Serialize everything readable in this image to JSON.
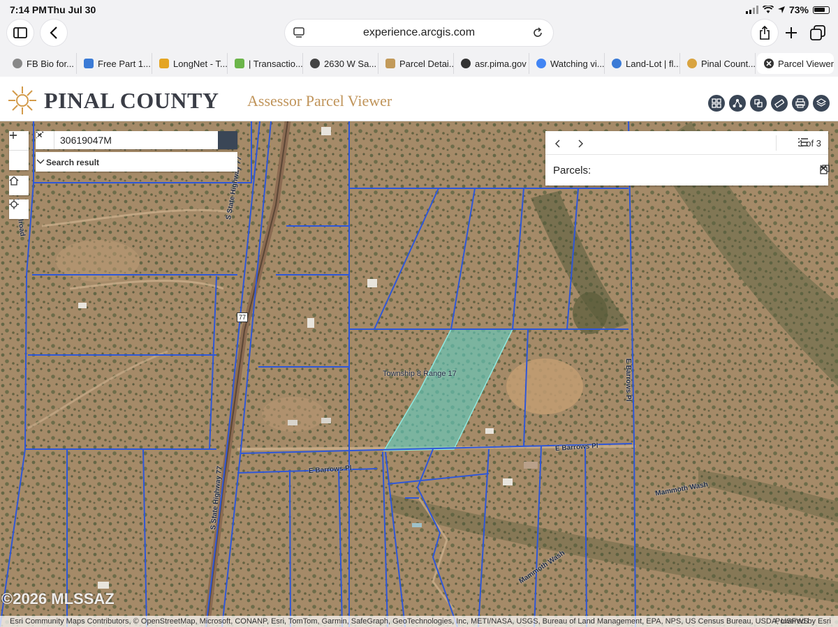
{
  "status_bar": {
    "time": "7:14 PM",
    "date": "Thu Jul 30",
    "battery_text": "73%",
    "battery_level": 0.73
  },
  "browser": {
    "url": "experience.arcgis.com",
    "tabs": [
      {
        "label": "FB Bio for...",
        "icon": "globe-icon",
        "color": "#888888"
      },
      {
        "label": "Free Part 1...",
        "icon": "doc-icon",
        "color": "#3b7bd6"
      },
      {
        "label": "LongNet - T...",
        "icon": "chart-icon",
        "color": "#e4a523"
      },
      {
        "label": "| Transactio...",
        "icon": "leaf-icon",
        "color": "#6cb54a"
      },
      {
        "label": "2630 W Sa...",
        "icon": "globe-icon",
        "color": "#444444"
      },
      {
        "label": "Parcel Detai...",
        "icon": "seal-icon",
        "color": "#c29a5a"
      },
      {
        "label": "asr.pima.gov",
        "icon": "a-icon",
        "color": "#333333"
      },
      {
        "label": "Watching vi...",
        "icon": "google-icon",
        "color": "#4285f4"
      },
      {
        "label": "Land-Lot | fl...",
        "icon": "pin-icon",
        "color": "#3b7bd6"
      },
      {
        "label": "Pinal Count...",
        "icon": "sun-icon",
        "color": "#d9a441"
      },
      {
        "label": "Parcel Viewer",
        "icon": "close-icon",
        "color": "#333333"
      }
    ]
  },
  "app": {
    "title": "PINAL COUNTY",
    "subtitle": "Assessor Parcel Viewer",
    "tools": [
      "basemap-gallery-icon",
      "share-icon",
      "layer-list-icon",
      "measure-icon",
      "print-icon",
      "layers-icon"
    ]
  },
  "search": {
    "value": "30619047M",
    "result_label": "Search result"
  },
  "popup": {
    "page_text": "1 of 3",
    "title": "Parcels:"
  },
  "map": {
    "labels": {
      "township": "Township 8 Range 17",
      "hwy_north": "S State Highway 77",
      "hwy_south": "S State Highway 77",
      "railroad": "na Railroad",
      "hwy_shield": "77",
      "barrows_w": "E Barrows Pl",
      "barrows_e": "E Barrows Pl",
      "barrows_v": "E Barrows Pl",
      "mammoth_1": "Mammoth Wash",
      "mammoth_2": "Mammoth Wash"
    },
    "highlight_color": "#5fd1c4",
    "parcel_line_color": "#2f57d8"
  },
  "attribution": {
    "left": "Esri Community Maps Contributors, © OpenStreetMap, Microsoft, CONANP, Esri, TomTom, Garmin, SafeGraph, GeoTechnologies, Inc, METI/NASA, USGS, Bureau of Land Management, EPA, NPS, US Census Bureau, USDA, USFWS",
    "right": "Powered by Esri"
  },
  "watermark": "©2026 MLSSAZ"
}
